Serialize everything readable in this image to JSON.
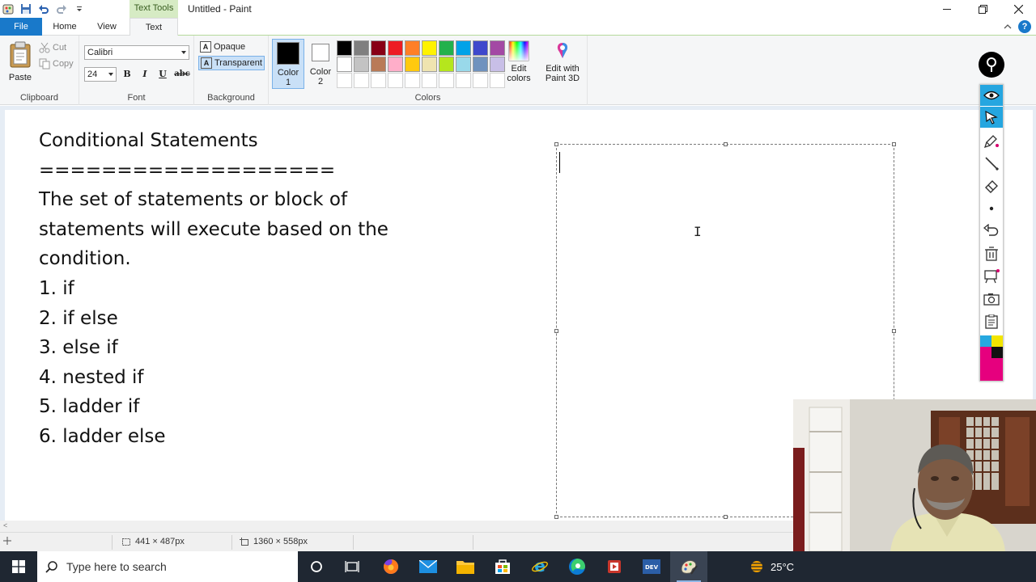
{
  "window": {
    "title": "Untitled - Paint",
    "context_tab": "Text Tools"
  },
  "tabs": [
    {
      "label": "File"
    },
    {
      "label": "Home"
    },
    {
      "label": "View"
    },
    {
      "label": "Text"
    }
  ],
  "ribbon": {
    "clipboard": {
      "group_label": "Clipboard",
      "paste": "Paste",
      "cut": "Cut",
      "copy": "Copy"
    },
    "font": {
      "group_label": "Font",
      "family": "Calibri",
      "size": "24",
      "bold": "B",
      "italic": "I",
      "underline": "U",
      "strike": "abc"
    },
    "background": {
      "group_label": "Background",
      "opaque": "Opaque",
      "transparent": "Transparent",
      "selected": "Transparent"
    },
    "colors": {
      "group_label": "Colors",
      "color1_label": "Color",
      "color1_num": "1",
      "color2_label": "Color",
      "color2_num": "2",
      "color1": "#000000",
      "color2": "#ffffff",
      "palette_row1": [
        "#000000",
        "#7f7f7f",
        "#880015",
        "#ed1c24",
        "#ff7f27",
        "#fff200",
        "#22b14c",
        "#00a2e8",
        "#3f48cc",
        "#a349a4"
      ],
      "palette_row2": [
        "#ffffff",
        "#c3c3c3",
        "#b97a57",
        "#ffaec9",
        "#ffc90e",
        "#efe4b0",
        "#b5e61d",
        "#99d9ea",
        "#7092be",
        "#c8bfe7"
      ],
      "palette_row3": [
        "#ffffff",
        "#ffffff",
        "#ffffff",
        "#ffffff",
        "#ffffff",
        "#ffffff",
        "#ffffff",
        "#ffffff",
        "#ffffff",
        "#ffffff"
      ],
      "edit_colors_line1": "Edit",
      "edit_colors_line2": "colors",
      "edit_p3d_line1": "Edit with",
      "edit_p3d_line2": "Paint 3D"
    }
  },
  "document": {
    "lines": [
      "Conditional Statements",
      "===================",
      "The set of statements or block of",
      "statements will execute based on the",
      "condition.",
      "1. if",
      "2. if else",
      "3. else if",
      "4. nested if",
      "5. ladder if",
      "6. ladder else"
    ]
  },
  "status": {
    "selection_size": "441 × 487px",
    "canvas_size": "1360 × 558px"
  },
  "annotation_tools": [
    "pin-icon",
    "eye-icon",
    "pointer-icon",
    "highlighter-icon",
    "pen-icon",
    "eraser-icon",
    "dot-icon",
    "undo-icon",
    "trash-icon",
    "whiteboard-icon",
    "camera-icon",
    "clipboard-icon",
    "color-picker-icon"
  ],
  "taskbar": {
    "search_placeholder": "Type here to search",
    "temperature": "25°C"
  },
  "colors": {
    "file_tab": "#1979ca",
    "context_tab_bg": "#d6ebc4",
    "taskbar": "#1f2732",
    "annot_active": "#25a6e0"
  }
}
